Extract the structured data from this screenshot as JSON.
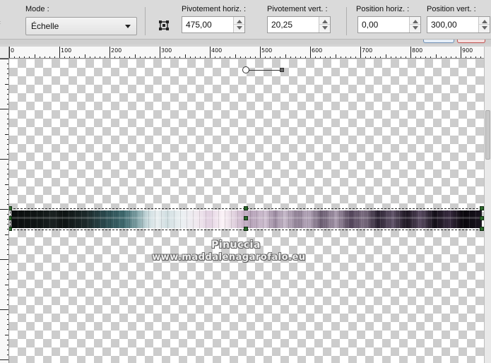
{
  "toolbar": {
    "mode_label": "Mode :",
    "mode_value": "Échelle",
    "pivot_h_label": "Pivotement horiz. :",
    "pivot_h_value": "475,00",
    "pivot_v_label": "Pivotement vert. :",
    "pivot_v_value": "20,25",
    "pos_h_label": "Position horiz. :",
    "pos_h_value": "0,00",
    "pos_v_label": "Position vert. :",
    "pos_v_value": "300,00"
  },
  "ruler": {
    "h_labels": [
      "0",
      "100",
      "200",
      "300",
      "400",
      "500",
      "600",
      "700",
      "800",
      "900"
    ]
  },
  "watermark": {
    "line1": "Pinuccia",
    "line2": "www.maddalenagarofalo.eu"
  },
  "colors": {
    "checker_dark": "#cccccc",
    "checker_light": "#ffffff",
    "handle_green": "#2d6b2d"
  }
}
